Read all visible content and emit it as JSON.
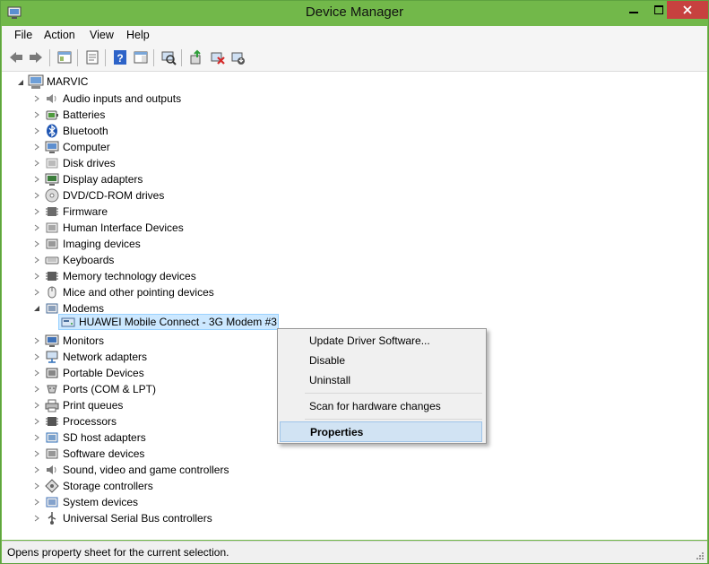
{
  "window": {
    "title": "Device Manager",
    "accent": "#72b84a",
    "close_color": "#c7413f"
  },
  "menu": [
    "File",
    "Action",
    "View",
    "Help"
  ],
  "toolbar_icons": [
    "back-icon",
    "forward-icon",
    "show-hide-tree-icon",
    "properties-icon",
    "help-icon",
    "action-pane-icon",
    "scan-hardware-icon",
    "update-driver-icon",
    "uninstall-icon",
    "disable-icon"
  ],
  "tree": {
    "root": "MARVIC",
    "categories": [
      {
        "label": "Audio inputs and outputs",
        "icon": "speaker-icon"
      },
      {
        "label": "Batteries",
        "icon": "battery-icon"
      },
      {
        "label": "Bluetooth",
        "icon": "bluetooth-icon"
      },
      {
        "label": "Computer",
        "icon": "computer-icon"
      },
      {
        "label": "Disk drives",
        "icon": "disk-drive-icon"
      },
      {
        "label": "Display adapters",
        "icon": "display-adapter-icon"
      },
      {
        "label": "DVD/CD-ROM drives",
        "icon": "dvd-icon"
      },
      {
        "label": "Firmware",
        "icon": "firmware-icon"
      },
      {
        "label": "Human Interface Devices",
        "icon": "hid-icon"
      },
      {
        "label": "Imaging devices",
        "icon": "camera-icon"
      },
      {
        "label": "Keyboards",
        "icon": "keyboard-icon"
      },
      {
        "label": "Memory technology devices",
        "icon": "memory-icon"
      },
      {
        "label": "Mice and other pointing devices",
        "icon": "mouse-icon"
      },
      {
        "label": "Modems",
        "icon": "modem-icon",
        "expanded": true
      }
    ],
    "modem_child": "HUAWEI Mobile Connect - 3G Modem #3",
    "categories_after": [
      {
        "label": "Monitors",
        "icon": "monitor-icon"
      },
      {
        "label": "Network adapters",
        "icon": "network-icon"
      },
      {
        "label": "Portable Devices",
        "icon": "portable-device-icon"
      },
      {
        "label": "Ports (COM & LPT)",
        "icon": "port-icon"
      },
      {
        "label": "Print queues",
        "icon": "printer-icon"
      },
      {
        "label": "Processors",
        "icon": "processor-icon"
      },
      {
        "label": "SD host adapters",
        "icon": "sd-card-icon"
      },
      {
        "label": "Software devices",
        "icon": "software-device-icon"
      },
      {
        "label": "Sound, video and game controllers",
        "icon": "sound-icon"
      },
      {
        "label": "Storage controllers",
        "icon": "storage-icon"
      },
      {
        "label": "System devices",
        "icon": "system-device-icon"
      },
      {
        "label": "Universal Serial Bus controllers",
        "icon": "usb-icon"
      }
    ]
  },
  "context_menu": {
    "update": "Update Driver Software...",
    "disable": "Disable",
    "uninstall": "Uninstall",
    "scan": "Scan for hardware changes",
    "properties": "Properties"
  },
  "status": "Opens property sheet for the current selection."
}
